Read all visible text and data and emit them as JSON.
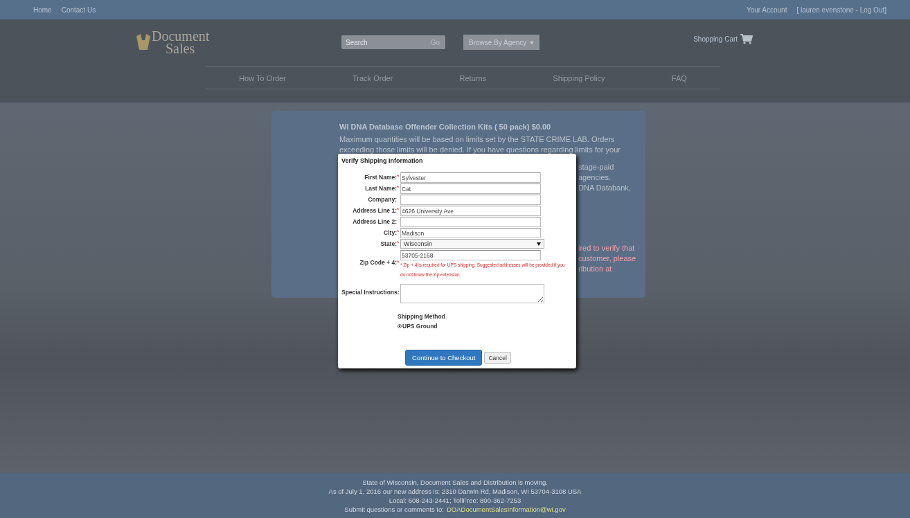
{
  "top_bar": {
    "links": [
      "Home",
      "Contact Us"
    ],
    "account": "Your Account",
    "user": "[ lauren evenstone - Log Out]"
  },
  "header": {
    "logo": [
      "Document",
      "Sales"
    ],
    "search": {
      "placeholder": "Search",
      "button": "Go"
    },
    "agency_button": "Browse By Agency",
    "cart": "Shopping Cart"
  },
  "nav": [
    "How To Order",
    "Track Order",
    "Returns",
    "Shipping Policy",
    "FAQ"
  ],
  "product": {
    "title": "WI DNA Database Offender Collection Kits ( 50 pack)  $0.00",
    "lines": [
      "Maximum quantities will be based on limits set by the STATE CRIME LAB. Orders",
      "exceeding those limits will be denied. If you have questions regarding limits for your"
    ],
    "fragments": [
      "stage-paid",
      "agencies.",
      "DNA Databank,"
    ],
    "red_fragments": [
      "ired to verify that",
      "customer, please",
      "ribution at"
    ]
  },
  "dialog": {
    "title": "Verify Shipping Information",
    "fields": [
      {
        "label": "First Name:",
        "required_mark": "*",
        "kind": "text",
        "value": "Sylvester"
      },
      {
        "label": "Last Name:",
        "required_mark": "*",
        "kind": "text",
        "value": "Cat"
      },
      {
        "label": "Company:",
        "kind": "text"
      },
      {
        "label": "Address Line 1:",
        "required_mark": "*",
        "kind": "text",
        "value": "4626 University Ave"
      },
      {
        "label": "Address Line 2:",
        "kind": "text"
      },
      {
        "label": "City:",
        "required_mark": "*",
        "kind": "text",
        "value": "Madison"
      },
      {
        "label": "State:",
        "required_mark": "*",
        "kind": "select",
        "value": "Wisconsin"
      },
      {
        "label": "Zip Code + 4:",
        "required_mark": "*",
        "kind": "text",
        "value": "53705-2168",
        "note": "* Zip + 4 is required for UPS shipping. Suggested addresses will be provided if you do not know the zip extension."
      },
      {
        "label": "Special Instructions:",
        "kind": "textarea"
      }
    ],
    "shipping": {
      "heading": "Shipping Method",
      "options": [
        {
          "label": "UPS Ground",
          "selected": true
        }
      ]
    },
    "buttons": [
      {
        "label": "Continue to Checkout",
        "kind": "primary"
      },
      {
        "label": "Cancel",
        "kind": "default"
      }
    ]
  },
  "footer": {
    "lines": [
      "State of Wisconsin, Document Sales and Distribution is moving.",
      "As of July 1, 2016 our new address is: 2310 Darwin Rd, Madison, WI 53704-3108 USA",
      "Local: 608-243-2441; TollFree: 800-362-7253"
    ],
    "contact_prefix": "Submit questions or comments to:",
    "email": "DOADocumentSalesInformation@wi.gov"
  }
}
